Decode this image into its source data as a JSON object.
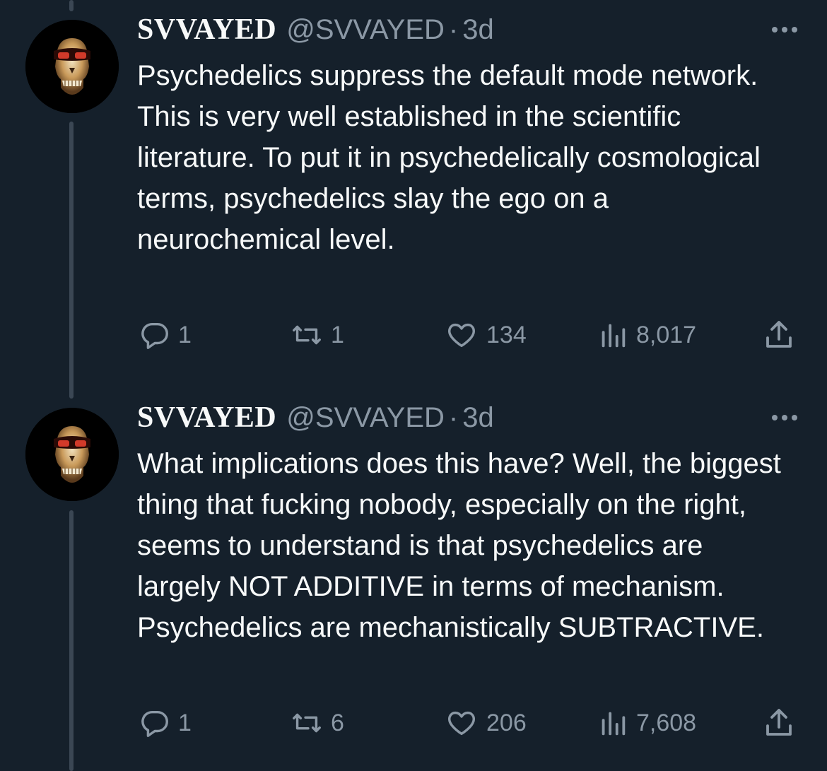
{
  "tweets": [
    {
      "display_name": "SVVAYED",
      "handle": "@SVVAYED",
      "separator": "·",
      "time": "3d",
      "text": "Psychedelics suppress the default mode network. This is very well established in the scientific literature. To put it in psychedelically cosmological terms, psychedelics slay the ego on a neurochemical level.",
      "replies": "1",
      "retweets": "1",
      "likes": "134",
      "views": "8,017"
    },
    {
      "display_name": "SVVAYED",
      "handle": "@SVVAYED",
      "separator": "·",
      "time": "3d",
      "text": "What implications does this have? Well, the biggest thing that fucking nobody, especially on the right, seems to understand is that psychedelics are largely NOT ADDITIVE in terms of mechanism. Psychedelics are mechanistically SUBTRACTIVE.",
      "replies": "1",
      "retweets": "6",
      "likes": "206",
      "views": "7,608"
    }
  ],
  "icons": {
    "reply": "reply-icon",
    "retweet": "retweet-icon",
    "like": "heart-icon",
    "views": "views-icon",
    "share": "share-icon",
    "more": "more-icon"
  },
  "colors": {
    "background": "#15202b",
    "text": "#f7f9f9",
    "muted": "#8b98a5",
    "thread_line": "#3b4754"
  }
}
